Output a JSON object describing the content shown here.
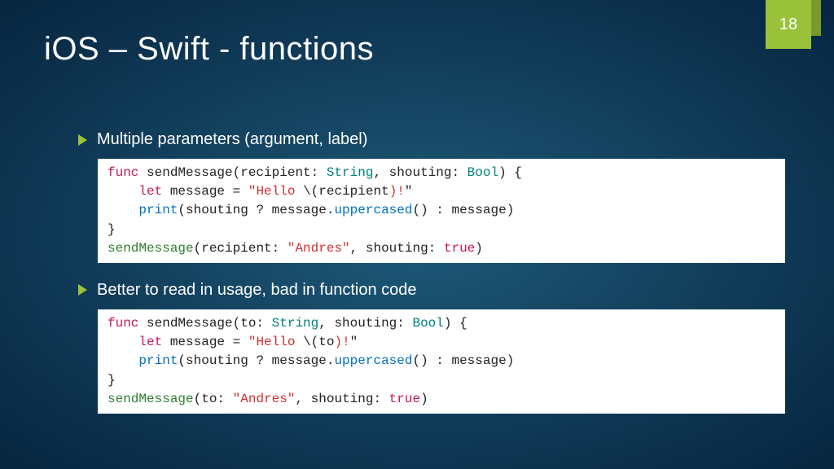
{
  "slide": {
    "number": "18",
    "title": "iOS – Swift - functions"
  },
  "bullets": {
    "b1": "Multiple parameters (argument, label)",
    "b2": "Better to read in usage, bad in function code"
  },
  "code1": {
    "t01": "func",
    "t02": " sendMessage(recipient: ",
    "t03": "String",
    "t04": ", shouting: ",
    "t05": "Bool",
    "t06": ") {",
    "t07": "    ",
    "t08": "let",
    "t09": " message = ",
    "t10": "\"Hello ",
    "t11": "\\(",
    "t12": "recipient",
    "t13": ")!",
    "t14": "\"",
    "t15": "    ",
    "t16": "print",
    "t17": "(shouting ? message.",
    "t18": "uppercased",
    "t19": "() : message)",
    "t20": "}",
    "t21": "sendMessage",
    "t22": "(recipient: ",
    "t23": "\"Andres\"",
    "t24": ", shouting: ",
    "t25": "true",
    "t26": ")"
  },
  "code2": {
    "t01": "func",
    "t02": " sendMessage(to: ",
    "t03": "String",
    "t04": ", shouting: ",
    "t05": "Bool",
    "t06": ") {",
    "t07": "    ",
    "t08": "let",
    "t09": " message = ",
    "t10": "\"Hello ",
    "t11": "\\(",
    "t12": "to",
    "t13": ")!",
    "t14": "\"",
    "t15": "    ",
    "t16": "print",
    "t17": "(shouting ? message.",
    "t18": "uppercased",
    "t19": "() : message)",
    "t20": "}",
    "t21": "sendMessage",
    "t22": "(to: ",
    "t23": "\"Andres\"",
    "t24": ", shouting: ",
    "t25": "true",
    "t26": ")"
  }
}
